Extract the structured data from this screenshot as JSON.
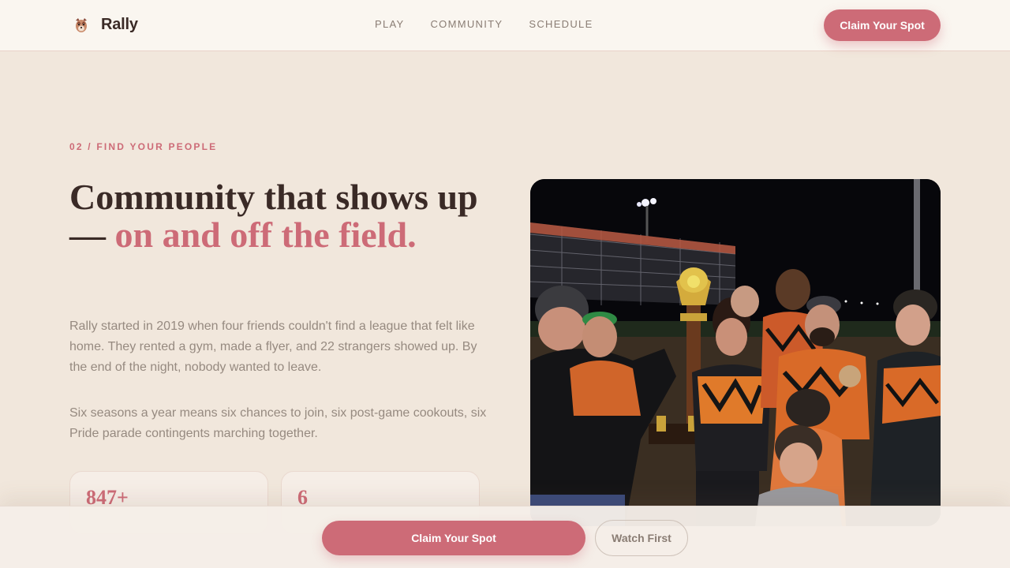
{
  "header": {
    "brand_name": "Rally",
    "nav": [
      {
        "label": "PLAY"
      },
      {
        "label": "COMMUNITY"
      },
      {
        "label": "SCHEDULE"
      }
    ],
    "cta_label": "Claim Your Spot"
  },
  "section": {
    "eyebrow": "02 / FIND YOUR PEOPLE",
    "headline_plain": "Community that shows up — ",
    "headline_accent": "on and off the field.",
    "paragraphs": [
      "Rally started in 2019 when four friends couldn't find a league that felt like home. They rented a gym, made a flyer, and 22 strangers showed up. By the end of the night, nobody wanted to leave.",
      "Six seasons a year means six chances to join, six post-game cookouts, six Pride parade contingents marching together."
    ],
    "stats": [
      {
        "value": "847+"
      },
      {
        "value": "6"
      }
    ]
  },
  "bottom_bar": {
    "primary_label": "Claim Your Spot",
    "secondary_label": "Watch First"
  },
  "colors": {
    "accent": "#cd6b77",
    "background": "#f1e7dc",
    "text_dark": "#3a2a26",
    "text_muted": "#968a80"
  },
  "icons": {
    "brand_logo": "team-mascot-icon"
  }
}
